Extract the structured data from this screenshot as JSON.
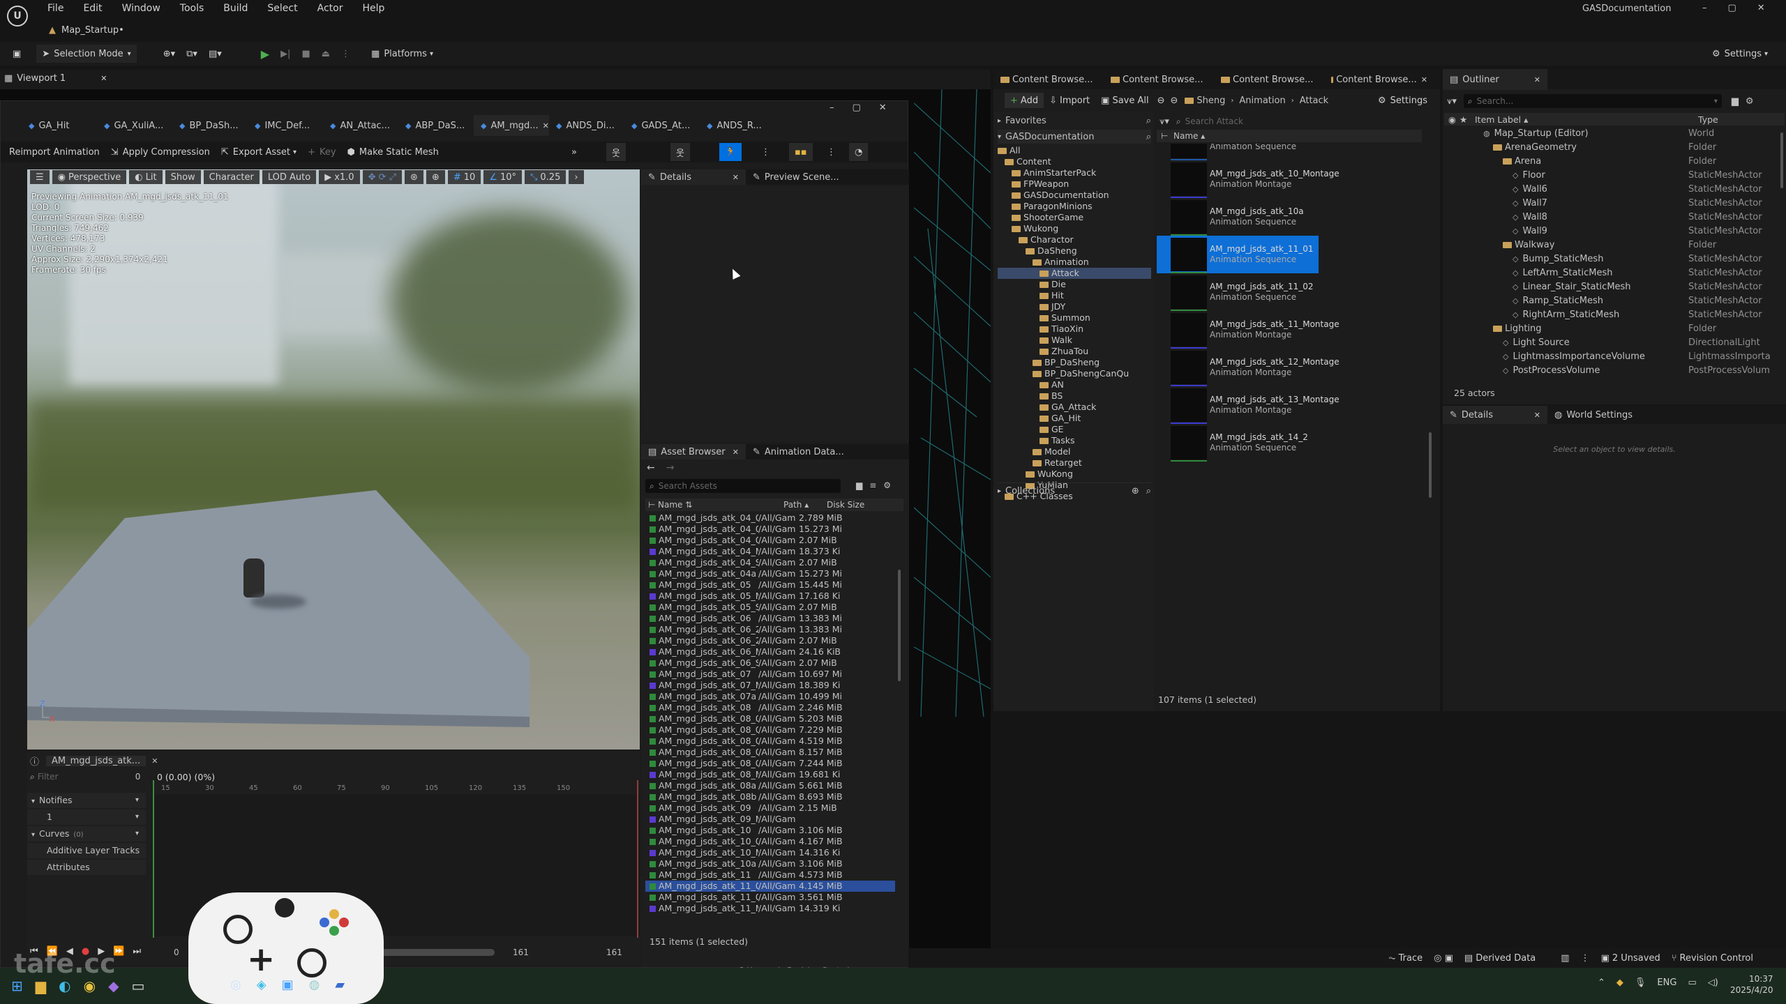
{
  "window": {
    "project_name": "GASDocumentation",
    "map_tab": "Map_Startup•",
    "controls": {
      "minimize": "–",
      "maximize": "▢",
      "close": "✕"
    }
  },
  "menu": [
    "File",
    "Edit",
    "Window",
    "Tools",
    "Build",
    "Select",
    "Actor",
    "Help"
  ],
  "toolbar": {
    "selection_mode": "Selection Mode",
    "platforms": "Platforms",
    "settings": "Settings"
  },
  "viewport_tab": "Viewport 1",
  "anim_editor": {
    "tabs": [
      "GA_Hit",
      "GA_XuliA...",
      "BP_DaSh...",
      "IMC_Def...",
      "AN_Attac...",
      "ABP_DaS...",
      "AM_mgd...",
      "ANDS_Di...",
      "GADS_At...",
      "ANDS_R..."
    ],
    "active_tab": "AM_mgd...",
    "toolbar": {
      "reimport": "Reimport Animation",
      "apply_compression": "Apply Compression",
      "export_asset": "Export Asset",
      "key": "Key",
      "make_static_mesh": "Make Static Mesh"
    },
    "viewport": {
      "perspective": "Perspective",
      "lit": "Lit",
      "show": "Show",
      "character": "Character",
      "lod_auto": "LOD Auto",
      "play_rate": "x1.0",
      "grid_size": "10",
      "rot_snap": "10°",
      "scale_snap": "0.25",
      "stats": [
        "Previewing Animation AM_mgd_jsds_atk_11_01",
        "LOD: 0",
        "Current Screen Size: 0.939",
        "Triangles: 749,462",
        "Vertices: 478,173",
        "UV Channels: 2",
        "Approx Size: 2,290x1,374x2,421",
        "Framerate: 30 fps"
      ]
    },
    "details_tab": "Details",
    "preview_tab": "Preview Scene...",
    "asset_browser": {
      "tab": "Asset Browser",
      "anim_data_tab": "Animation Data...",
      "search_placeholder": "Search Assets",
      "col_name": "Name",
      "col_path": "Path",
      "col_size": "Disk Size",
      "rows": [
        [
          "AM_mgd_jsds_atk_04_01",
          "/All/Gam",
          "2.789 MiB",
          "g"
        ],
        [
          "AM_mgd_jsds_atk_04_01_",
          "/All/Gam",
          "15.273 Mi",
          "g"
        ],
        [
          "AM_mgd_jsds_atk_04_01_",
          "/All/Gam",
          "2.07 MiB",
          "g"
        ],
        [
          "AM_mgd_jsds_atk_04_Mo",
          "/All/Gam",
          "18.373 Ki",
          "p"
        ],
        [
          "AM_mgd_jsds_atk_04_SEC",
          "/All/Gam",
          "2.07 MiB",
          "g"
        ],
        [
          "AM_mgd_jsds_atk_04a",
          "/All/Gam",
          "15.273 Mi",
          "g"
        ],
        [
          "AM_mgd_jsds_atk_05",
          "/All/Gam",
          "15.445 Mi",
          "g"
        ],
        [
          "AM_mgd_jsds_atk_05_Mo",
          "/All/Gam",
          "17.168 Ki",
          "p"
        ],
        [
          "AM_mgd_jsds_atk_05_SEC",
          "/All/Gam",
          "2.07 MiB",
          "g"
        ],
        [
          "AM_mgd_jsds_atk_06",
          "/All/Gam",
          "13.383 Mi",
          "g"
        ],
        [
          "AM_mgd_jsds_atk_06_2",
          "/All/Gam",
          "13.383 Mi",
          "g"
        ],
        [
          "AM_mgd_jsds_atk_06_2_S",
          "/All/Gam",
          "2.07 MiB",
          "g"
        ],
        [
          "AM_mgd_jsds_atk_06_Mo",
          "/All/Gam",
          "24.16 KiB",
          "p"
        ],
        [
          "AM_mgd_jsds_atk_06_SEC",
          "/All/Gam",
          "2.07 MiB",
          "g"
        ],
        [
          "AM_mgd_jsds_atk_07",
          "/All/Gam",
          "10.697 Mi",
          "g"
        ],
        [
          "AM_mgd_jsds_atk_07_Mo",
          "/All/Gam",
          "18.389 Ki",
          "p"
        ],
        [
          "AM_mgd_jsds_atk_07a",
          "/All/Gam",
          "10.499 Mi",
          "g"
        ],
        [
          "AM_mgd_jsds_atk_08",
          "/All/Gam",
          "2.246 MiB",
          "g"
        ],
        [
          "AM_mgd_jsds_atk_08_01",
          "/All/Gam",
          "5.203 MiB",
          "g"
        ],
        [
          "AM_mgd_jsds_atk_08_01_",
          "/All/Gam",
          "7.229 MiB",
          "g"
        ],
        [
          "AM_mgd_jsds_atk_08_01_",
          "/All/Gam",
          "4.519 MiB",
          "g"
        ],
        [
          "AM_mgd_jsds_atk_08_02",
          "/All/Gam",
          "8.157 MiB",
          "g"
        ],
        [
          "AM_mgd_jsds_atk_08_03",
          "/All/Gam",
          "7.244 MiB",
          "g"
        ],
        [
          "AM_mgd_jsds_atk_08_Mo",
          "/All/Gam",
          "19.681 Ki",
          "p"
        ],
        [
          "AM_mgd_jsds_atk_08a",
          "/All/Gam",
          "5.661 MiB",
          "g"
        ],
        [
          "AM_mgd_jsds_atk_08b",
          "/All/Gam",
          "8.693 MiB",
          "g"
        ],
        [
          "AM_mgd_jsds_atk_09",
          "/All/Gam",
          "2.15 MiB",
          "g"
        ],
        [
          "AM_mgd_jsds_atk_09_Mo",
          "/All/Gam",
          "",
          "p"
        ],
        [
          "AM_mgd_jsds_atk_10",
          "/All/Gam",
          "3.106 MiB",
          "g"
        ],
        [
          "AM_mgd_jsds_atk_10_01",
          "/All/Gam",
          "4.167 MiB",
          "g"
        ],
        [
          "AM_mgd_jsds_atk_10_Mo",
          "/All/Gam",
          "14.316 Ki",
          "p"
        ],
        [
          "AM_mgd_jsds_atk_10a",
          "/All/Gam",
          "3.106 MiB",
          "g"
        ],
        [
          "AM_mgd_jsds_atk_11",
          "/All/Gam",
          "4.573 MiB",
          "g"
        ],
        [
          "AM_mgd_jsds_atk_11_01",
          "/All/Gam",
          "4.145 MiB",
          "g"
        ],
        [
          "AM_mgd_jsds_atk_11_02",
          "/All/Gam",
          "3.561 MiB",
          "g"
        ],
        [
          "AM_mgd_jsds_atk_11_Mo",
          "/All/Gam",
          "14.319 Ki",
          "p"
        ]
      ],
      "selected_index": 33,
      "count": "151 items (1 selected)"
    },
    "timeline": {
      "tab": "AM_mgd_jsds_atk...",
      "filter_placeholder": "Filter",
      "filter_count": "0",
      "time_readout": "0 (0.00) (0%)",
      "ruler": [
        "15",
        "30",
        "45",
        "60",
        "75",
        "90",
        "105",
        "120",
        "135",
        "150"
      ],
      "tracks": [
        "Notifies",
        "1",
        "Curves",
        "Additive Layer Tracks",
        "Attributes"
      ],
      "curves_count": "(0)",
      "frame_start": "0",
      "frame_end": "161",
      "frame_total": "161"
    }
  },
  "content_browser": {
    "tabs": [
      "Content Browse...",
      "Content Browse...",
      "Content Browse...",
      "Content Browse..."
    ],
    "add": "Add",
    "import": "Import",
    "save_all": "Save All",
    "breadcrumb": [
      "Sheng",
      "Animation",
      "Attack"
    ],
    "settings": "Settings",
    "favorites": "Favorites",
    "project": "GASDocumentation",
    "search_placeholder": "Search Attack",
    "col_name": "Name",
    "tree": [
      [
        "All",
        0
      ],
      [
        "Content",
        1
      ],
      [
        "AnimStarterPack",
        2
      ],
      [
        "FPWeapon",
        2
      ],
      [
        "GASDocumentation",
        2
      ],
      [
        "ParagonMinions",
        2
      ],
      [
        "ShooterGame",
        2
      ],
      [
        "Wukong",
        2
      ],
      [
        "Charactor",
        3
      ],
      [
        "DaSheng",
        4
      ],
      [
        "Animation",
        5
      ],
      [
        "Attack",
        6
      ],
      [
        "Die",
        6
      ],
      [
        "Hit",
        6
      ],
      [
        "JDY",
        6
      ],
      [
        "Summon",
        6
      ],
      [
        "TiaoXin",
        6
      ],
      [
        "Walk",
        6
      ],
      [
        "ZhuaTou",
        6
      ],
      [
        "BP_DaSheng",
        5
      ],
      [
        "BP_DaShengCanQu",
        5
      ],
      [
        "AN",
        6
      ],
      [
        "BS",
        6
      ],
      [
        "GA_Attack",
        6
      ],
      [
        "GA_Hit",
        6
      ],
      [
        "GE",
        6
      ],
      [
        "Tasks",
        6
      ],
      [
        "Model",
        5
      ],
      [
        "Retarget",
        5
      ],
      [
        "WuKong",
        4
      ],
      [
        "YuMian",
        4
      ],
      [
        "C++ Classes",
        1
      ]
    ],
    "tiles": [
      {
        "name": "",
        "type": "Animation Sequence",
        "line": "#1e5aa8"
      },
      {
        "name": "AM_mgd_jsds_atk_10_Montage",
        "type": "Animation Montage",
        "line": "#3a3ad0"
      },
      {
        "name": "AM_mgd_jsds_atk_10a",
        "type": "Animation Sequence",
        "line": "#2f8a3c"
      },
      {
        "name": "AM_mgd_jsds_atk_11_01",
        "type": "Animation Sequence",
        "line": "#2f8a3c"
      },
      {
        "name": "AM_mgd_jsds_atk_11_02",
        "type": "Animation Sequence",
        "line": "#2f8a3c"
      },
      {
        "name": "AM_mgd_jsds_atk_11_Montage",
        "type": "Animation Montage",
        "line": "#3a3ad0"
      },
      {
        "name": "AM_mgd_jsds_atk_12_Montage",
        "type": "Animation Montage",
        "line": "#3a3ad0"
      },
      {
        "name": "AM_mgd_jsds_atk_13_Montage",
        "type": "Animation Montage",
        "line": "#3a3ad0"
      },
      {
        "name": "AM_mgd_jsds_atk_14_2",
        "type": "Animation Sequence",
        "line": "#2f8a3c"
      }
    ],
    "selected_tile": 3,
    "collections": "Collections",
    "count": "107 items (1 selected)"
  },
  "outliner": {
    "tab": "Outliner",
    "search_placeholder": "Search...",
    "col_label": "Item Label",
    "col_type": "Type",
    "rows": [
      [
        "Map_Startup (Editor)",
        "World",
        0
      ],
      [
        "ArenaGeometry",
        "Folder",
        1
      ],
      [
        "Arena",
        "Folder",
        2
      ],
      [
        "Floor",
        "StaticMeshActor",
        3
      ],
      [
        "Wall6",
        "StaticMeshActor",
        3
      ],
      [
        "Wall7",
        "StaticMeshActor",
        3
      ],
      [
        "Wall8",
        "StaticMeshActor",
        3
      ],
      [
        "Wall9",
        "StaticMeshActor",
        3
      ],
      [
        "Walkway",
        "Folder",
        2
      ],
      [
        "Bump_StaticMesh",
        "StaticMeshActor",
        3
      ],
      [
        "LeftArm_StaticMesh",
        "StaticMeshActor",
        3
      ],
      [
        "Linear_Stair_StaticMesh",
        "StaticMeshActor",
        3
      ],
      [
        "Ramp_StaticMesh",
        "StaticMeshActor",
        3
      ],
      [
        "RightArm_StaticMesh",
        "StaticMeshActor",
        3
      ],
      [
        "Lighting",
        "Folder",
        1
      ],
      [
        "Light Source",
        "DirectionalLight",
        2
      ],
      [
        "LightmassImportanceVolume",
        "LightmassImporta",
        2
      ],
      [
        "PostProcessVolume",
        "PostProcessVolum",
        2
      ]
    ],
    "actor_count": "25 actors",
    "details_tab": "Details",
    "world_settings_tab": "World Settings",
    "details_hint": "Select an object to view details."
  },
  "status_bar": {
    "trace": "Trace",
    "derived_data": "Derived Data",
    "unsaved": "2 Unsaved",
    "revision_control": "Revision Control",
    "inner_unsaved": "2 Unsaved",
    "inner_revision": "Revision Control"
  },
  "taskbar": {
    "language": "ENG",
    "time": "10:37",
    "date": "2025/4/20",
    "watermark": "tafe.cc"
  },
  "colors": {
    "accent": "#0070e0",
    "selected_tile": "#0e6fd6",
    "ui_dark": "#151515",
    "panel": "#202020"
  }
}
